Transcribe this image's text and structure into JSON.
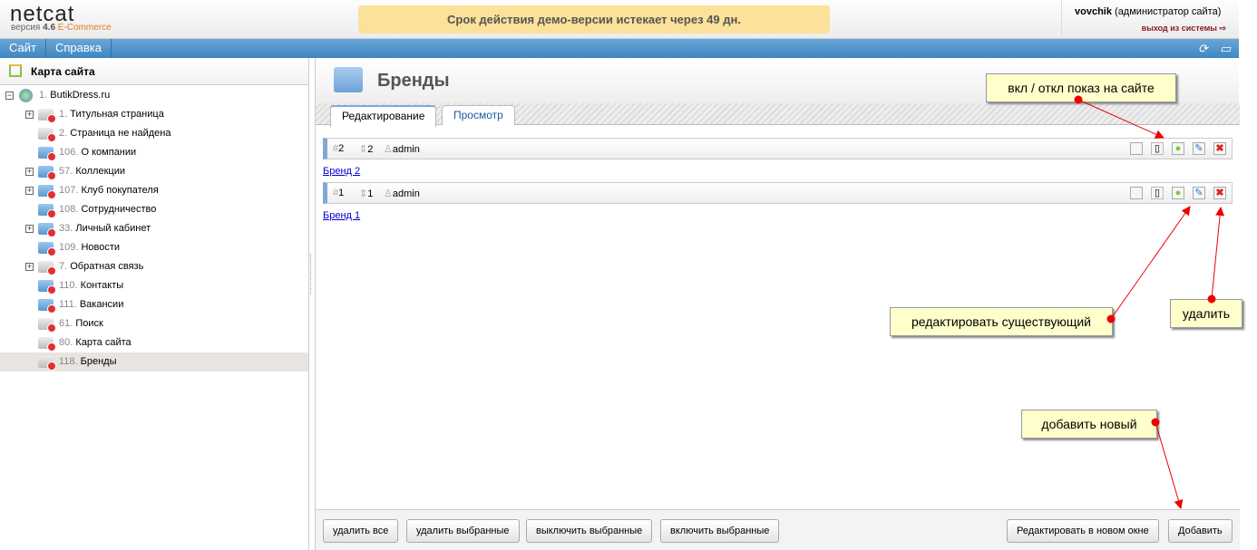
{
  "header": {
    "logo": "netcat",
    "version_label": "версия",
    "version": "4.6",
    "edition": "E-Commerce",
    "demo_notice": "Срок действия демо-версии истекает через 49 дн.",
    "user_name": "vovchik",
    "user_role": "(администратор сайта)",
    "logout": "выход из системы"
  },
  "menu": {
    "items": [
      "Сайт",
      "Справка"
    ]
  },
  "sidebar": {
    "title": "Карта сайта",
    "root": {
      "num": "1.",
      "label": "ButikDress.ru"
    },
    "items": [
      {
        "num": "1.",
        "label": "Титульная страница",
        "expand": true,
        "color": "gray"
      },
      {
        "num": "2.",
        "label": "Страница не найдена",
        "expand": false,
        "color": "gray"
      },
      {
        "num": "106.",
        "label": "О компании",
        "expand": false,
        "color": "blue"
      },
      {
        "num": "57.",
        "label": "Коллекции",
        "expand": true,
        "color": "blue"
      },
      {
        "num": "107.",
        "label": "Клуб покупателя",
        "expand": true,
        "color": "blue"
      },
      {
        "num": "108.",
        "label": "Сотрудничество",
        "expand": false,
        "color": "blue"
      },
      {
        "num": "33.",
        "label": "Личный кабинет",
        "expand": true,
        "color": "blue"
      },
      {
        "num": "109.",
        "label": "Новости",
        "expand": false,
        "color": "blue"
      },
      {
        "num": "7.",
        "label": "Обратная связь",
        "expand": true,
        "color": "gray"
      },
      {
        "num": "110.",
        "label": "Контакты",
        "expand": false,
        "color": "blue"
      },
      {
        "num": "111.",
        "label": "Вакансии",
        "expand": false,
        "color": "blue"
      },
      {
        "num": "61.",
        "label": "Поиск",
        "expand": false,
        "color": "gray"
      },
      {
        "num": "80.",
        "label": "Карта сайта",
        "expand": false,
        "color": "gray"
      },
      {
        "num": "118.",
        "label": "Бренды",
        "expand": false,
        "color": "gray",
        "selected": true
      }
    ]
  },
  "main": {
    "title": "Бренды",
    "tabs": [
      "Редактирование",
      "Просмотр"
    ],
    "records": [
      {
        "id": "2",
        "priority": "2",
        "user": "admin",
        "link": "Бренд 2"
      },
      {
        "id": "1",
        "priority": "1",
        "user": "admin",
        "link": "Бренд 1"
      }
    ],
    "buttons_left": [
      "удалить все",
      "удалить выбранные",
      "выключить выбранные",
      "включить выбранные"
    ],
    "buttons_right": [
      "Редактировать в новом окне",
      "Добавить"
    ]
  },
  "callouts": {
    "toggle": "вкл / откл показ на сайте",
    "edit": "редактировать существующий",
    "delete": "удалить",
    "add": "добавить новый"
  }
}
